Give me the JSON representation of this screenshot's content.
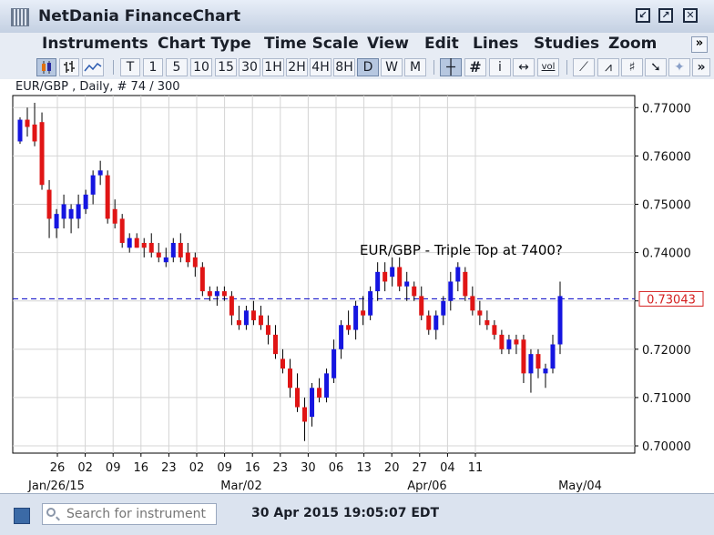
{
  "window": {
    "title": "NetDania FinanceChart",
    "controls": [
      "minimize",
      "maximize",
      "close"
    ]
  },
  "menu": {
    "items": [
      "Instruments",
      "Chart Type",
      "Time Scale",
      "View",
      "Edit",
      "Lines",
      "Studies",
      "Zoom"
    ],
    "overflow_label": "»"
  },
  "toolbar": {
    "chart_styles": [
      {
        "name": "candles-icon",
        "active": true
      },
      {
        "name": "ohlc-bars-icon",
        "active": false
      },
      {
        "name": "line-chart-icon",
        "active": false
      }
    ],
    "timescales": [
      {
        "label": "T",
        "active": false
      },
      {
        "label": "1",
        "active": false
      },
      {
        "label": "5",
        "active": false
      },
      {
        "label": "10",
        "active": false
      },
      {
        "label": "15",
        "active": false
      },
      {
        "label": "30",
        "active": false
      },
      {
        "label": "1H",
        "active": false
      },
      {
        "label": "2H",
        "active": false
      },
      {
        "label": "4H",
        "active": false
      },
      {
        "label": "8H",
        "active": false
      },
      {
        "label": "D",
        "active": true
      },
      {
        "label": "W",
        "active": false
      },
      {
        "label": "M",
        "active": false
      }
    ],
    "tools": [
      {
        "name": "crosshair-icon",
        "label": "┼",
        "active": true
      },
      {
        "name": "grid-icon",
        "label": "#",
        "active": false
      },
      {
        "name": "info-icon",
        "label": "i",
        "active": false
      },
      {
        "name": "scale-icon",
        "label": "↔",
        "active": false
      },
      {
        "name": "volume-icon",
        "label": "vol",
        "active": false
      }
    ],
    "drawing_tools": [
      {
        "name": "trendline-icon",
        "label": "⟋"
      },
      {
        "name": "fan-lines-icon",
        "label": "⩘"
      },
      {
        "name": "fibonacci-icon",
        "label": "♯"
      },
      {
        "name": "pointer-icon",
        "label": "➘"
      },
      {
        "name": "marker-icon",
        "label": "✦"
      }
    ],
    "overflow_label": "»"
  },
  "chart_header": "EUR/GBP , Daily, # 74 / 300",
  "status": {
    "search_placeholder": "Search for instrument",
    "timestamp": "30 Apr 2015 19:05:07 EDT"
  },
  "colors": {
    "up_candle": "#1515e0",
    "down_candle": "#e01515",
    "wick": "#000000",
    "reference_line": "#1a1acc",
    "price_tag_border": "#d42020"
  },
  "chart_data": {
    "type": "candlestick",
    "title": "",
    "annotation": "EUR/GBP - Triple Top at 7400?",
    "ylim": [
      0.6985,
      0.7725
    ],
    "y_ticks": [
      "0.77000",
      "0.76000",
      "0.75000",
      "0.74000",
      "0.73000",
      "0.72000",
      "0.71000",
      "0.70000"
    ],
    "x_ticks": [
      "26",
      "02",
      "09",
      "16",
      "23",
      "02",
      "09",
      "16",
      "23",
      "30",
      "06",
      "13",
      "20",
      "27",
      "04",
      "11"
    ],
    "period_labels": [
      "Jan/26/15",
      "Mar/02",
      "Apr/06",
      "May/04"
    ],
    "reference_line": {
      "value": 0.73043,
      "label": "0.73043",
      "style": "dashed"
    },
    "candles": [
      [
        0.763,
        0.768,
        0.7625,
        0.7675
      ],
      [
        0.7675,
        0.77,
        0.764,
        0.766
      ],
      [
        0.7665,
        0.771,
        0.762,
        0.763
      ],
      [
        0.767,
        0.769,
        0.753,
        0.754
      ],
      [
        0.753,
        0.755,
        0.743,
        0.747
      ],
      [
        0.745,
        0.749,
        0.743,
        0.748
      ],
      [
        0.747,
        0.752,
        0.745,
        0.75
      ],
      [
        0.747,
        0.75,
        0.744,
        0.749
      ],
      [
        0.747,
        0.752,
        0.745,
        0.75
      ],
      [
        0.749,
        0.753,
        0.748,
        0.752
      ],
      [
        0.752,
        0.757,
        0.75,
        0.756
      ],
      [
        0.756,
        0.759,
        0.754,
        0.757
      ],
      [
        0.756,
        0.757,
        0.746,
        0.747
      ],
      [
        0.749,
        0.751,
        0.745,
        0.746
      ],
      [
        0.747,
        0.748,
        0.741,
        0.742
      ],
      [
        0.741,
        0.744,
        0.74,
        0.743
      ],
      [
        0.743,
        0.744,
        0.741,
        0.741
      ],
      [
        0.742,
        0.743,
        0.739,
        0.741
      ],
      [
        0.742,
        0.744,
        0.739,
        0.74
      ],
      [
        0.74,
        0.742,
        0.738,
        0.739
      ],
      [
        0.738,
        0.741,
        0.737,
        0.739
      ],
      [
        0.739,
        0.743,
        0.738,
        0.742
      ],
      [
        0.742,
        0.744,
        0.738,
        0.739
      ],
      [
        0.74,
        0.742,
        0.737,
        0.738
      ],
      [
        0.739,
        0.74,
        0.735,
        0.737
      ],
      [
        0.737,
        0.738,
        0.731,
        0.732
      ],
      [
        0.732,
        0.733,
        0.73,
        0.731
      ],
      [
        0.731,
        0.733,
        0.729,
        0.732
      ],
      [
        0.732,
        0.733,
        0.73,
        0.731
      ],
      [
        0.731,
        0.732,
        0.725,
        0.727
      ],
      [
        0.726,
        0.729,
        0.724,
        0.725
      ],
      [
        0.725,
        0.729,
        0.724,
        0.728
      ],
      [
        0.728,
        0.73,
        0.725,
        0.726
      ],
      [
        0.727,
        0.729,
        0.724,
        0.725
      ],
      [
        0.725,
        0.727,
        0.721,
        0.723
      ],
      [
        0.723,
        0.725,
        0.718,
        0.719
      ],
      [
        0.718,
        0.72,
        0.715,
        0.716
      ],
      [
        0.716,
        0.718,
        0.71,
        0.712
      ],
      [
        0.712,
        0.715,
        0.707,
        0.708
      ],
      [
        0.708,
        0.71,
        0.701,
        0.705
      ],
      [
        0.706,
        0.713,
        0.704,
        0.712
      ],
      [
        0.712,
        0.714,
        0.709,
        0.71
      ],
      [
        0.71,
        0.716,
        0.709,
        0.715
      ],
      [
        0.714,
        0.722,
        0.713,
        0.72
      ],
      [
        0.72,
        0.726,
        0.718,
        0.725
      ],
      [
        0.725,
        0.728,
        0.723,
        0.724
      ],
      [
        0.724,
        0.73,
        0.722,
        0.729
      ],
      [
        0.728,
        0.731,
        0.725,
        0.727
      ],
      [
        0.727,
        0.733,
        0.726,
        0.732
      ],
      [
        0.732,
        0.738,
        0.73,
        0.736
      ],
      [
        0.736,
        0.738,
        0.732,
        0.734
      ],
      [
        0.735,
        0.739,
        0.733,
        0.737
      ],
      [
        0.737,
        0.739,
        0.732,
        0.733
      ],
      [
        0.733,
        0.736,
        0.73,
        0.734
      ],
      [
        0.733,
        0.734,
        0.73,
        0.731
      ],
      [
        0.731,
        0.733,
        0.726,
        0.727
      ],
      [
        0.727,
        0.728,
        0.723,
        0.724
      ],
      [
        0.724,
        0.728,
        0.722,
        0.727
      ],
      [
        0.727,
        0.731,
        0.725,
        0.73
      ],
      [
        0.73,
        0.736,
        0.728,
        0.734
      ],
      [
        0.734,
        0.738,
        0.732,
        0.737
      ],
      [
        0.736,
        0.737,
        0.73,
        0.731
      ],
      [
        0.731,
        0.733,
        0.727,
        0.728
      ],
      [
        0.728,
        0.73,
        0.725,
        0.727
      ],
      [
        0.726,
        0.728,
        0.724,
        0.725
      ],
      [
        0.725,
        0.726,
        0.722,
        0.723
      ],
      [
        0.723,
        0.724,
        0.719,
        0.72
      ],
      [
        0.72,
        0.723,
        0.719,
        0.722
      ],
      [
        0.722,
        0.723,
        0.719,
        0.721
      ],
      [
        0.722,
        0.723,
        0.713,
        0.715
      ],
      [
        0.715,
        0.72,
        0.711,
        0.719
      ],
      [
        0.719,
        0.72,
        0.714,
        0.716
      ],
      [
        0.715,
        0.717,
        0.712,
        0.716
      ],
      [
        0.716,
        0.723,
        0.715,
        0.721
      ],
      [
        0.721,
        0.734,
        0.719,
        0.731
      ]
    ]
  }
}
